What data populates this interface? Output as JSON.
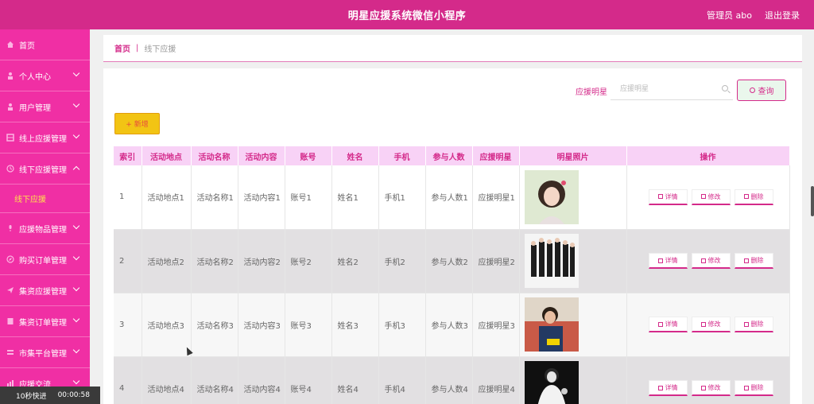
{
  "header": {
    "title": "明星应援系统微信小程序",
    "user": "管理员 abo",
    "logout": "退出登录"
  },
  "sidebar": {
    "items": [
      {
        "label": "首页",
        "icon": "home-icon",
        "chevron": "none"
      },
      {
        "label": "个人中心",
        "icon": "person-icon",
        "chevron": "down"
      },
      {
        "label": "用户管理",
        "icon": "person-icon",
        "chevron": "down"
      },
      {
        "label": "线上应援管理",
        "icon": "grid-icon",
        "chevron": "down"
      },
      {
        "label": "线下应援管理",
        "icon": "clock-icon",
        "chevron": "up"
      },
      {
        "label": "应援物品管理",
        "icon": "mic-icon",
        "chevron": "down"
      },
      {
        "label": "购买订单管理",
        "icon": "compass-icon",
        "chevron": "down"
      },
      {
        "label": "集资应援管理",
        "icon": "send-icon",
        "chevron": "down"
      },
      {
        "label": "集资订单管理",
        "icon": "book-icon",
        "chevron": "down"
      },
      {
        "label": "市集平台管理",
        "icon": "list-icon",
        "chevron": "down"
      },
      {
        "label": "应援交流",
        "icon": "chart-icon",
        "chevron": "down"
      }
    ],
    "active_sub": "线下应援"
  },
  "breadcrumb": {
    "home": "首页",
    "separator": "|",
    "current": "线下应援"
  },
  "search": {
    "label": "应援明星",
    "placeholder": "应援明星",
    "button": "查询"
  },
  "add_button": "+ 新增",
  "table": {
    "headers": [
      "索引",
      "活动地点",
      "活动名称",
      "活动内容",
      "账号",
      "姓名",
      "手机",
      "参与人数",
      "应援明星",
      "明星照片",
      "操作"
    ],
    "ops": [
      "详情",
      "修改",
      "删除"
    ],
    "rows": [
      [
        "1",
        "活动地点1",
        "活动名称1",
        "活动内容1",
        "账号1",
        "姓名1",
        "手机1",
        "参与人数1",
        "应援明星1"
      ],
      [
        "2",
        "活动地点2",
        "活动名称2",
        "活动内容2",
        "账号2",
        "姓名2",
        "手机2",
        "参与人数2",
        "应援明星2"
      ],
      [
        "3",
        "活动地点3",
        "活动名称3",
        "活动内容3",
        "账号3",
        "姓名3",
        "手机3",
        "参与人数3",
        "应援明星3"
      ],
      [
        "4",
        "活动地点4",
        "活动名称4",
        "活动内容4",
        "账号4",
        "姓名4",
        "手机4",
        "参与人数4",
        "应援明星4"
      ]
    ]
  },
  "timer": {
    "label": "10秒快进",
    "time": "00:00:58"
  },
  "colors": {
    "brand": "#d42a8a",
    "sidebar": "#f02fa4",
    "table_header": "#f8d2f6"
  }
}
